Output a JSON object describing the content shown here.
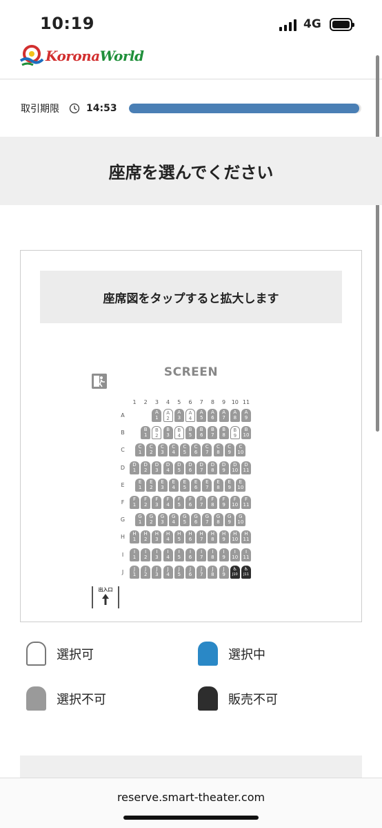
{
  "status_bar": {
    "time": "10:19",
    "network": "4G"
  },
  "logo": {
    "text_prefix": "Korona",
    "text_suffix": "World"
  },
  "deadline": {
    "label": "取引期限",
    "time": "14:53",
    "progress": 0.99
  },
  "page_heading": "座席を選んでください",
  "seat_map": {
    "tap_hint": "座席図をタップすると拡大します",
    "screen_label": "SCREEN",
    "entrance_label": "出入口",
    "column_numbers": [
      "1",
      "2",
      "3",
      "4",
      "5",
      "6",
      "7",
      "8",
      "9",
      "10",
      "11"
    ],
    "rows": [
      {
        "label": "A",
        "first_col": 3,
        "seats": [
          {
            "n": "1",
            "s": "unavailable"
          },
          {
            "n": "2",
            "s": "available"
          },
          {
            "n": "3",
            "s": "unavailable"
          },
          {
            "n": "4",
            "s": "available"
          },
          {
            "n": "5",
            "s": "unavailable"
          },
          {
            "n": "6",
            "s": "unavailable"
          },
          {
            "n": "7",
            "s": "unavailable"
          },
          {
            "n": "8",
            "s": "unavailable"
          },
          {
            "n": "9",
            "s": "unavailable"
          }
        ]
      },
      {
        "label": "B",
        "first_col": 2,
        "seats": [
          {
            "n": "1",
            "s": "unavailable"
          },
          {
            "n": "2",
            "s": "available"
          },
          {
            "n": "3",
            "s": "unavailable"
          },
          {
            "n": "4",
            "s": "available"
          },
          {
            "n": "5",
            "s": "unavailable"
          },
          {
            "n": "6",
            "s": "unavailable"
          },
          {
            "n": "7",
            "s": "unavailable"
          },
          {
            "n": "8",
            "s": "unavailable"
          },
          {
            "n": "9",
            "s": "available"
          },
          {
            "n": "10",
            "s": "unavailable"
          }
        ]
      },
      {
        "label": "C",
        "first_col": 1.5,
        "seats": [
          {
            "n": "1",
            "s": "unavailable"
          },
          {
            "n": "2",
            "s": "unavailable"
          },
          {
            "n": "3",
            "s": "unavailable"
          },
          {
            "n": "4",
            "s": "unavailable"
          },
          {
            "n": "5",
            "s": "unavailable"
          },
          {
            "n": "6",
            "s": "unavailable"
          },
          {
            "n": "7",
            "s": "unavailable"
          },
          {
            "n": "8",
            "s": "unavailable"
          },
          {
            "n": "9",
            "s": "unavailable"
          },
          {
            "n": "10",
            "s": "unavailable"
          }
        ]
      },
      {
        "label": "D",
        "first_col": 1,
        "seats": [
          {
            "n": "1",
            "s": "unavailable"
          },
          {
            "n": "2",
            "s": "unavailable"
          },
          {
            "n": "3",
            "s": "unavailable"
          },
          {
            "n": "4",
            "s": "unavailable"
          },
          {
            "n": "5",
            "s": "unavailable"
          },
          {
            "n": "6",
            "s": "unavailable"
          },
          {
            "n": "7",
            "s": "unavailable"
          },
          {
            "n": "8",
            "s": "unavailable"
          },
          {
            "n": "9",
            "s": "unavailable"
          },
          {
            "n": "10",
            "s": "unavailable"
          },
          {
            "n": "11",
            "s": "unavailable"
          }
        ]
      },
      {
        "label": "E",
        "first_col": 1.5,
        "seats": [
          {
            "n": "1",
            "s": "unavailable"
          },
          {
            "n": "2",
            "s": "unavailable"
          },
          {
            "n": "3",
            "s": "unavailable"
          },
          {
            "n": "4",
            "s": "unavailable"
          },
          {
            "n": "5",
            "s": "unavailable"
          },
          {
            "n": "6",
            "s": "unavailable"
          },
          {
            "n": "7",
            "s": "unavailable"
          },
          {
            "n": "8",
            "s": "unavailable"
          },
          {
            "n": "9",
            "s": "unavailable"
          },
          {
            "n": "10",
            "s": "unavailable"
          }
        ]
      },
      {
        "label": "F",
        "first_col": 1,
        "seats": [
          {
            "n": "1",
            "s": "unavailable"
          },
          {
            "n": "2",
            "s": "unavailable"
          },
          {
            "n": "3",
            "s": "unavailable"
          },
          {
            "n": "4",
            "s": "unavailable"
          },
          {
            "n": "5",
            "s": "unavailable"
          },
          {
            "n": "6",
            "s": "unavailable"
          },
          {
            "n": "7",
            "s": "unavailable"
          },
          {
            "n": "8",
            "s": "unavailable"
          },
          {
            "n": "9",
            "s": "unavailable"
          },
          {
            "n": "10",
            "s": "unavailable"
          },
          {
            "n": "11",
            "s": "unavailable"
          }
        ]
      },
      {
        "label": "G",
        "first_col": 1.5,
        "seats": [
          {
            "n": "1",
            "s": "unavailable"
          },
          {
            "n": "2",
            "s": "unavailable"
          },
          {
            "n": "3",
            "s": "unavailable"
          },
          {
            "n": "4",
            "s": "unavailable"
          },
          {
            "n": "5",
            "s": "unavailable"
          },
          {
            "n": "6",
            "s": "unavailable"
          },
          {
            "n": "7",
            "s": "unavailable"
          },
          {
            "n": "8",
            "s": "unavailable"
          },
          {
            "n": "9",
            "s": "unavailable"
          },
          {
            "n": "10",
            "s": "unavailable"
          }
        ]
      },
      {
        "label": "H",
        "first_col": 1,
        "seats": [
          {
            "n": "1",
            "s": "unavailable"
          },
          {
            "n": "2",
            "s": "unavailable"
          },
          {
            "n": "3",
            "s": "unavailable"
          },
          {
            "n": "4",
            "s": "unavailable"
          },
          {
            "n": "5",
            "s": "unavailable"
          },
          {
            "n": "6",
            "s": "unavailable"
          },
          {
            "n": "7",
            "s": "unavailable"
          },
          {
            "n": "8",
            "s": "unavailable"
          },
          {
            "n": "9",
            "s": "unavailable"
          },
          {
            "n": "10",
            "s": "unavailable"
          },
          {
            "n": "11",
            "s": "unavailable"
          }
        ]
      },
      {
        "label": "I",
        "first_col": 1,
        "seats": [
          {
            "n": "1",
            "s": "unavailable"
          },
          {
            "n": "2",
            "s": "unavailable"
          },
          {
            "n": "3",
            "s": "unavailable"
          },
          {
            "n": "4",
            "s": "unavailable"
          },
          {
            "n": "5",
            "s": "unavailable"
          },
          {
            "n": "6",
            "s": "unavailable"
          },
          {
            "n": "7",
            "s": "unavailable"
          },
          {
            "n": "8",
            "s": "unavailable"
          },
          {
            "n": "9",
            "s": "unavailable"
          },
          {
            "n": "10",
            "s": "unavailable"
          },
          {
            "n": "11",
            "s": "unavailable"
          }
        ]
      },
      {
        "label": "J",
        "first_col": 1,
        "seats": [
          {
            "n": "1",
            "s": "unavailable"
          },
          {
            "n": "2",
            "s": "unavailable"
          },
          {
            "n": "3",
            "s": "unavailable"
          },
          {
            "n": "4",
            "s": "unavailable"
          },
          {
            "n": "5",
            "s": "unavailable"
          },
          {
            "n": "6",
            "s": "unavailable"
          },
          {
            "n": "7",
            "s": "unavailable"
          },
          {
            "n": "8",
            "s": "unavailable"
          },
          {
            "n": "9",
            "s": "unavailable"
          },
          {
            "n": "J10",
            "s": "not-for-sale",
            "wheelchair": true
          },
          {
            "n": "J11",
            "s": "not-for-sale",
            "wheelchair": true
          }
        ]
      }
    ]
  },
  "legend": {
    "available": "選択可",
    "selected": "選択中",
    "unavailable": "選択不可",
    "not_for_sale": "販売不可"
  },
  "colors": {
    "accent": "#4a7fb5",
    "selected": "#2a88c6",
    "unavailable": "#9a9a9a",
    "not_for_sale": "#2d2d2d"
  },
  "browser": {
    "url": "reserve.smart-theater.com"
  }
}
